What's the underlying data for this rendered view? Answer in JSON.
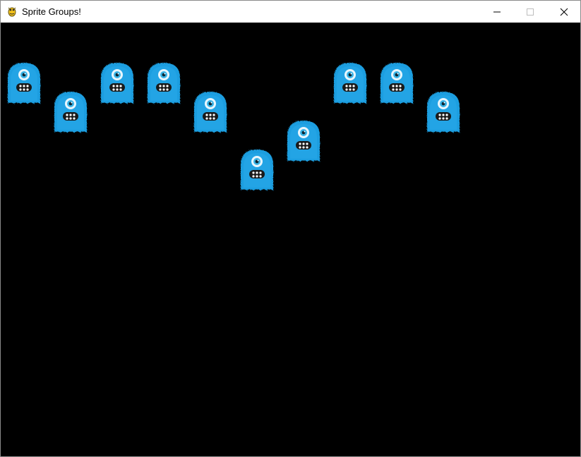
{
  "window": {
    "title": "Sprite Groups!",
    "app_icon": "pygame-snake-icon",
    "controls": [
      "minimize-icon",
      "maximize-icon",
      "close-icon"
    ]
  },
  "game": {
    "background_color": "#000000",
    "sprite_name": "blue-furry-one-eyed-monster",
    "sprite_color": "#1b9ee0",
    "sprite_count": 10
  }
}
